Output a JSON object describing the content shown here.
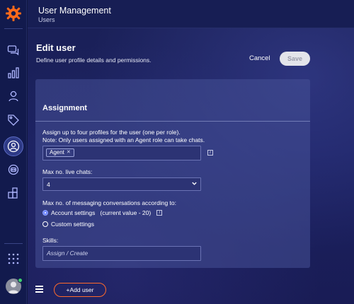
{
  "app": {
    "title": "User Management",
    "subtitle": "Users"
  },
  "page": {
    "title": "Edit user",
    "description": "Define user profile details and permissions."
  },
  "actions": {
    "cancel_label": "Cancel",
    "save_label": "Save"
  },
  "assignment": {
    "section_title": "Assignment",
    "profiles_label_line1": "Assign up to four profiles for the user (one per role).",
    "profiles_label_line2": "Note: Only users assigned with an Agent role can take chats.",
    "profile_tags": [
      "Agent"
    ],
    "tag_remove_glyph": "✕",
    "info_glyph": "i",
    "max_live_chats_label": "Max no. live chats:",
    "max_live_chats_value": "4",
    "max_messaging_label": "Max no. of messaging conversations according to:",
    "radio_account_label": "Account settings",
    "radio_account_detail": "(current value - 20)",
    "radio_custom_label": "Custom settings",
    "radio_selected": "account",
    "skills_label": "Skills:",
    "skills_placeholder": "Assign / Create"
  },
  "footer": {
    "add_user_label": "+Add user"
  },
  "rail": {
    "icons": [
      "logo-icon",
      "chat-icon",
      "analytics-icon",
      "agent-icon",
      "tag-icon",
      "users-icon",
      "bot-icon",
      "integrations-icon",
      "apps-grid-icon",
      "avatar"
    ],
    "active": "users-icon"
  },
  "colors": {
    "accent": "#ff6a2b",
    "panel": "#46508f",
    "background": "#1a2056"
  }
}
